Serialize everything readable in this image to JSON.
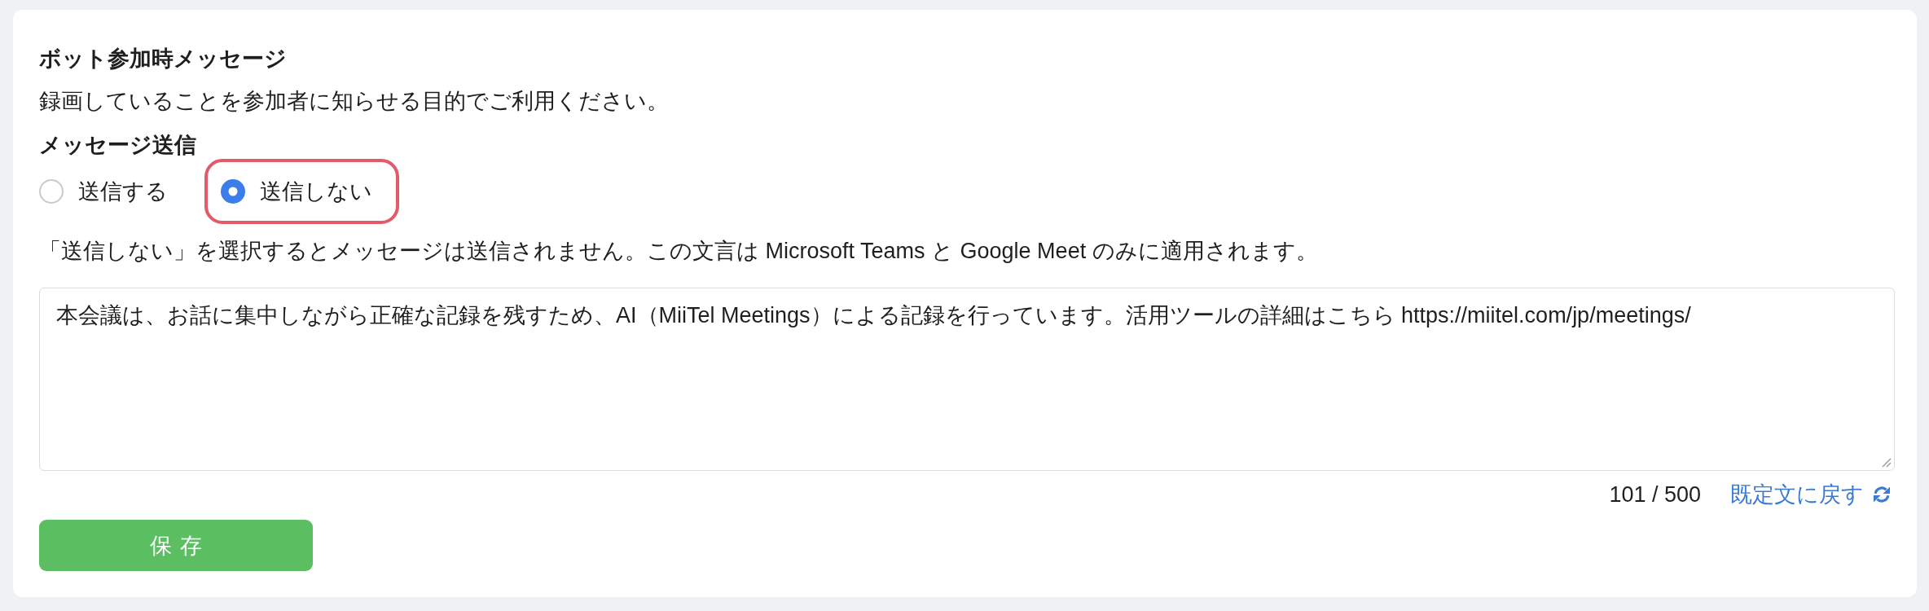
{
  "section": {
    "title": "ボット参加時メッセージ",
    "description": "録画していることを参加者に知らせる目的でご利用ください。"
  },
  "message_sending": {
    "label": "メッセージ送信",
    "options": [
      {
        "label": "送信する",
        "selected": false,
        "highlighted": false
      },
      {
        "label": "送信しない",
        "selected": true,
        "highlighted": true
      }
    ],
    "note": "「送信しない」を選択するとメッセージは送信されません。この文言は Microsoft Teams と Google Meet のみに適用されます。"
  },
  "message": {
    "value": "本会議は、お話に集中しながら正確な記録を残すため、AI（MiiTel Meetings）による記録を行っています。活用ツールの詳細はこちら https://miitel.com/jp/meetings/",
    "counter": "101 / 500",
    "reset_link": "既定文に戻す"
  },
  "save_button": "保存"
}
